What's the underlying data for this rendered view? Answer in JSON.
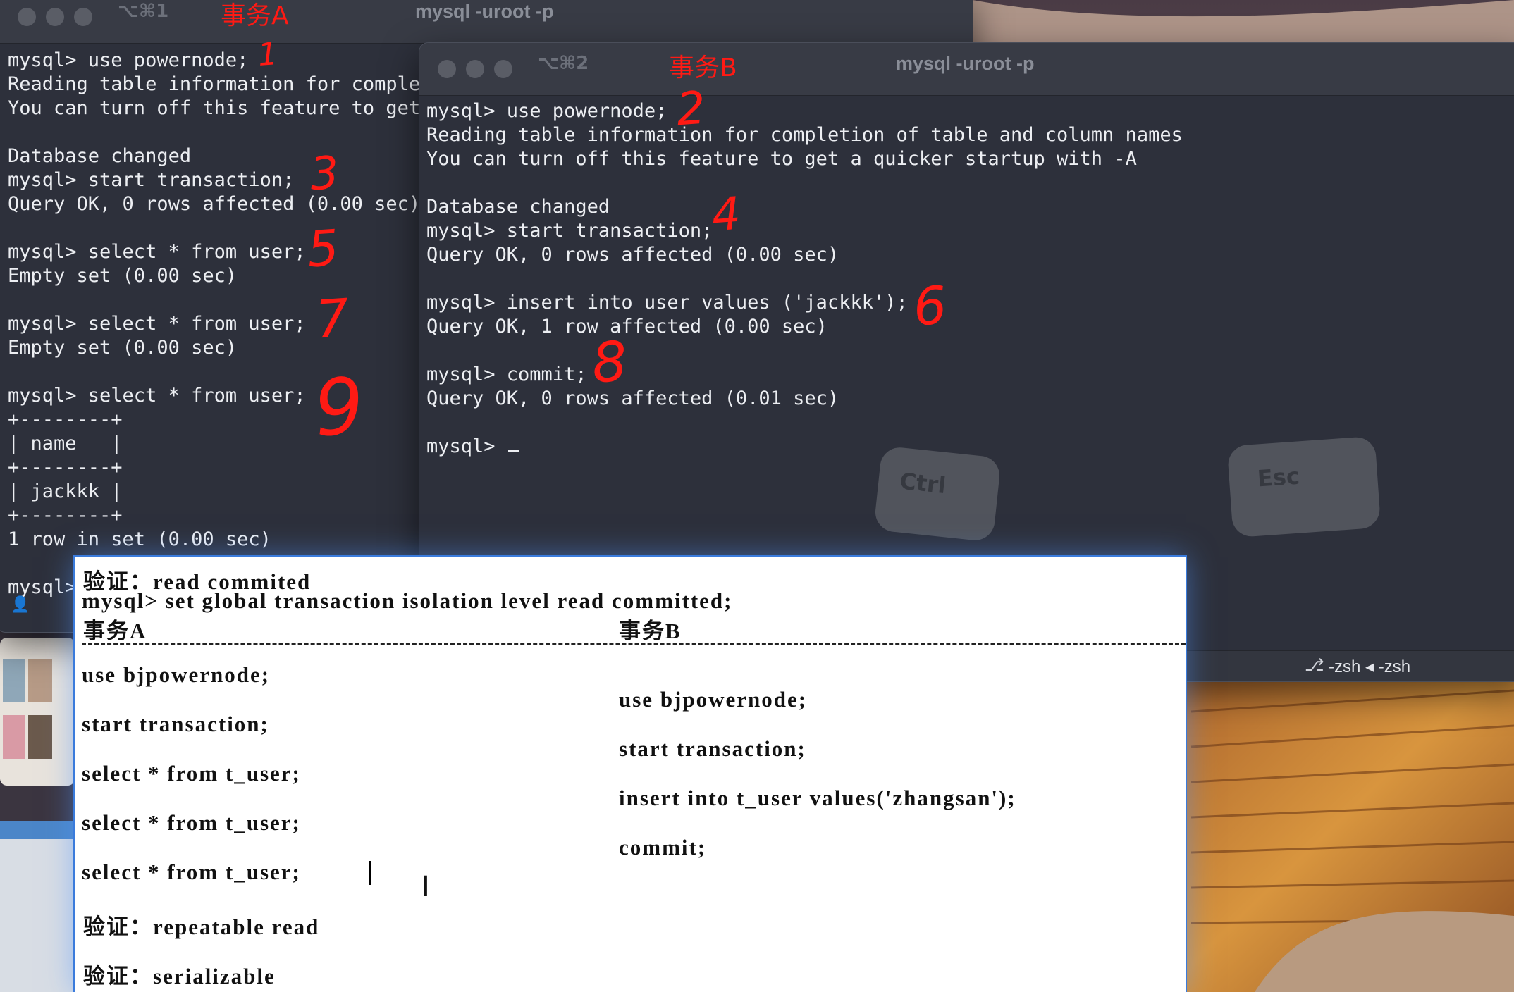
{
  "terminal_a": {
    "shortcut": "⌥⌘1",
    "title": "mysql -uroot -p",
    "label": "事务A",
    "lines": [
      "mysql> use powernode;",
      "Reading table information for complet",
      "You can turn off this feature to get",
      "",
      "Database changed",
      "mysql> start transaction;",
      "Query OK, 0 rows affected (0.00 sec)",
      "",
      "mysql> select * from user;",
      "Empty set (0.00 sec)",
      "",
      "mysql> select * from user;",
      "Empty set (0.00 sec)",
      "",
      "mysql> select * from user;",
      "+--------+",
      "| name   |",
      "+--------+",
      "| jackkk |",
      "+--------+",
      "1 row in set (0.00 sec)",
      "",
      "mysql>"
    ],
    "annotations": [
      "1",
      "3",
      "5",
      "7",
      "9"
    ]
  },
  "terminal_b": {
    "shortcut": "⌥⌘2",
    "title": "mysql -uroot -p",
    "label": "事务B",
    "lines": [
      "mysql> use powernode;",
      "Reading table information for completion of table and column names",
      "You can turn off this feature to get a quicker startup with -A",
      "",
      "Database changed",
      "mysql> start transaction;",
      "Query OK, 0 rows affected (0.00 sec)",
      "",
      "mysql> insert into user values ('jackkk');",
      "Query OK, 1 row affected (0.00 sec)",
      "",
      "mysql> commit;",
      "Query OK, 0 rows affected (0.01 sec)",
      "",
      "mysql> "
    ],
    "annotations": [
      "2",
      "4",
      "6",
      "8"
    ],
    "status": "-zsh ◂ -zsh",
    "wallpaper_keys": [
      "Ctrl",
      "Esc"
    ]
  },
  "document": {
    "verify1": "验证：read commited",
    "set_cmd": "mysql> set global transaction isolation level read committed;",
    "col_a_header": "事务A",
    "col_b_header": "事务B",
    "a_steps": [
      "use bjpowernode;",
      "start transaction;",
      "select * from t_user;",
      "select * from t_user;",
      "select * from t_user;"
    ],
    "b_steps": [
      "use bjpowernode;",
      "start transaction;",
      "insert into t_user values('zhangsan');",
      "commit;"
    ],
    "verify2": "验证：repeatable read",
    "verify3": "验证：serializable"
  },
  "colors": {
    "terminal_bg": "#2d303b",
    "annotation": "#ff1a14",
    "document_bg": "#ffffff"
  }
}
